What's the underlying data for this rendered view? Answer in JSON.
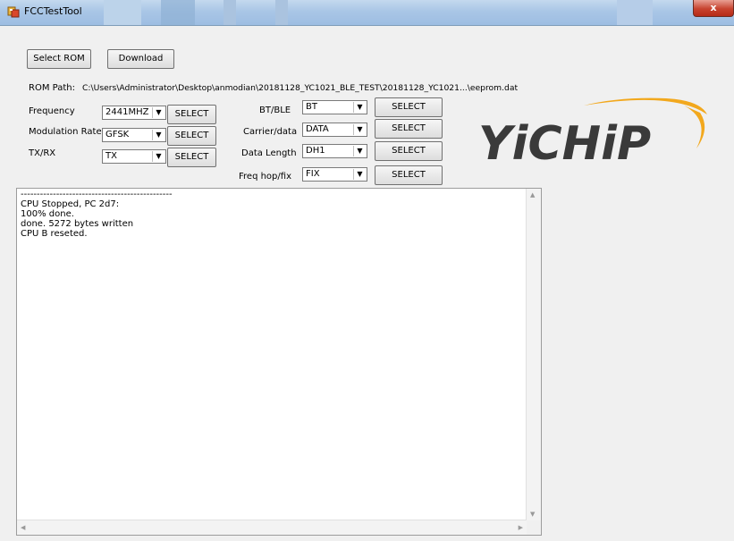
{
  "window": {
    "title": "FCCTestTool",
    "close_label": "x"
  },
  "toolbar": {
    "select_rom": "Select ROM",
    "download": "Download"
  },
  "rom_path": {
    "label": "ROM Path:",
    "value": "C:\\Users\\Administrator\\Desktop\\anmodian\\20181128_YC1021_BLE_TEST\\20181128_YC1021...\\eeprom.dat"
  },
  "left_settings": [
    {
      "label": "Frequency",
      "value": "2441MHZ",
      "button": "SELECT"
    },
    {
      "label": "Modulation Rate",
      "value": "GFSK",
      "button": "SELECT"
    },
    {
      "label": "TX/RX",
      "value": "TX",
      "button": "SELECT"
    }
  ],
  "right_settings": [
    {
      "label": "BT/BLE",
      "value": "BT",
      "button": "SELECT"
    },
    {
      "label": "Carrier/data",
      "value": "DATA",
      "button": "SELECT"
    },
    {
      "label": "Data Length",
      "value": "DH1",
      "button": "SELECT"
    },
    {
      "label": "Freq hop/fix",
      "value": "FIX",
      "button": "SELECT"
    }
  ],
  "logo": {
    "text": "YiCHiP",
    "color": "#3a3a3a",
    "swoosh_color": "#f2a81d"
  },
  "log": {
    "separator": "-----------------------------------------------",
    "lines": [
      "CPU Stopped, PC 2d7:",
      "100% done.",
      "done. 5272 bytes written",
      "CPU B reseted."
    ]
  }
}
